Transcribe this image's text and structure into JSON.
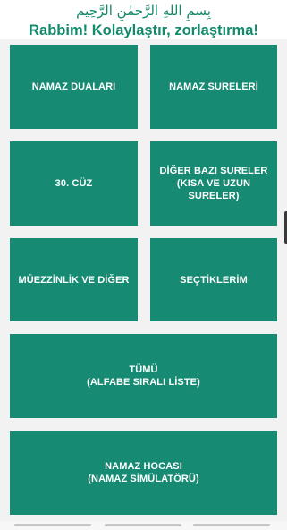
{
  "header": {
    "bismillah": "بِسمِ اللهِ الرَّحمٰنِ الرَّحِيم",
    "subtitle": "Rabbim! Kolaylaştır, zorlaştırma!"
  },
  "menu": {
    "items": [
      {
        "label": "NAMAZ DUALARI"
      },
      {
        "label": "NAMAZ SURELERİ"
      },
      {
        "label": "30. CÜZ"
      },
      {
        "label": "DİĞER BAZI SURELER\n(KISA VE UZUN SURELER)"
      },
      {
        "label": "MÜEZZİNLİK VE DİĞER"
      },
      {
        "label": "SEÇTİKLERİM"
      },
      {
        "label": "TÜMÜ\n(ALFABE SIRALI LİSTE)"
      },
      {
        "label": "NAMAZ HOCASI\n(NAMAZ SİMÜLATÖRÜ)"
      }
    ]
  },
  "colors": {
    "accent_text": "#128a6b",
    "tile_background": "#168a72",
    "content_background": "#f2f2f2"
  }
}
